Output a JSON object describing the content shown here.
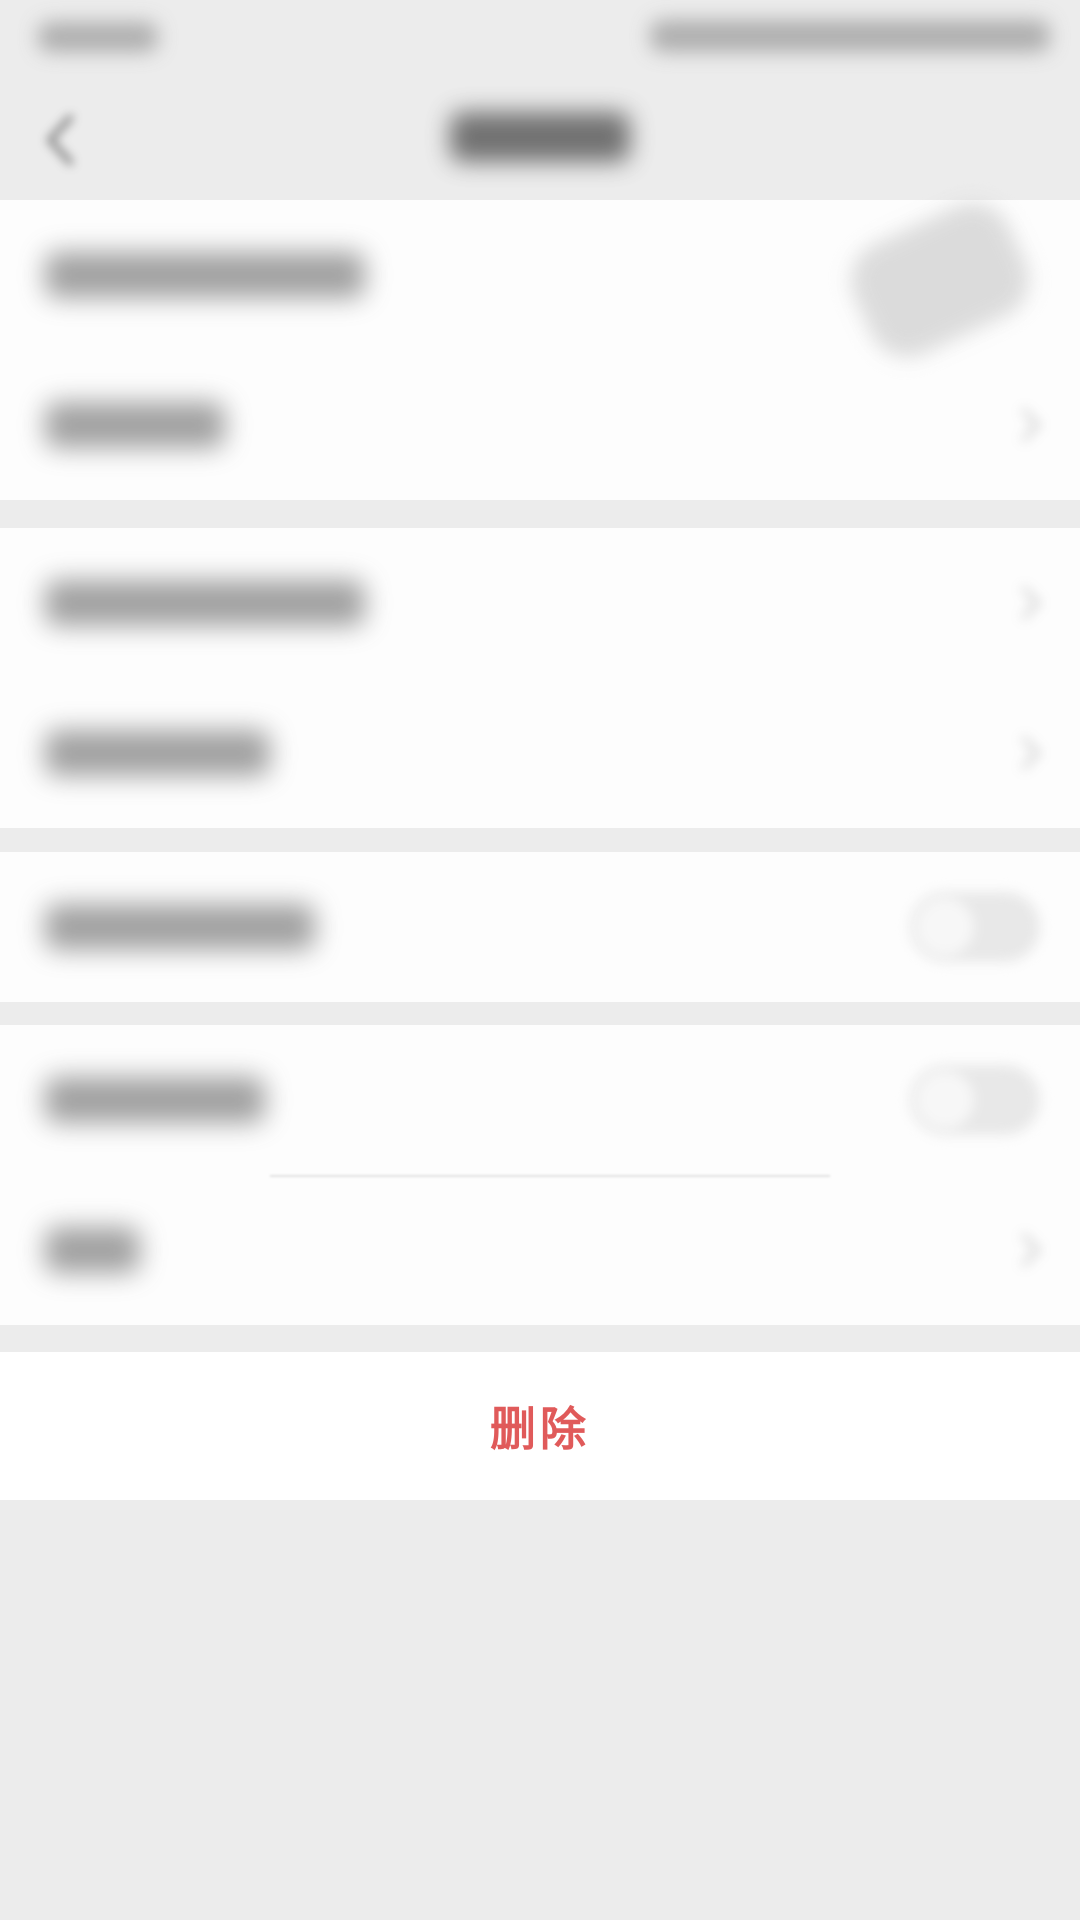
{
  "status_bar": {
    "time": "",
    "indicators": ""
  },
  "nav": {
    "back_icon": "chevron-left-icon",
    "title": ""
  },
  "settings": {
    "groups": [
      {
        "rows": [
          {
            "label": "",
            "trailing": "avatar"
          },
          {
            "label": "",
            "trailing": "chevron-right-icon"
          }
        ]
      },
      {
        "rows": [
          {
            "label": "",
            "trailing": "chevron-right-icon"
          },
          {
            "label": "",
            "trailing": "chevron-right-icon"
          }
        ]
      },
      {
        "rows": [
          {
            "label": "",
            "trailing": "toggle",
            "toggle_on": false
          }
        ]
      },
      {
        "rows": [
          {
            "label": "",
            "trailing": "toggle",
            "toggle_on": false
          },
          {
            "label": "",
            "trailing": "chevron-right-icon"
          }
        ]
      }
    ]
  },
  "actions": {
    "delete_label": "删除",
    "delete_color": "#e05a5a"
  },
  "colors": {
    "background": "#ececec",
    "card": "#fdfdfd"
  }
}
